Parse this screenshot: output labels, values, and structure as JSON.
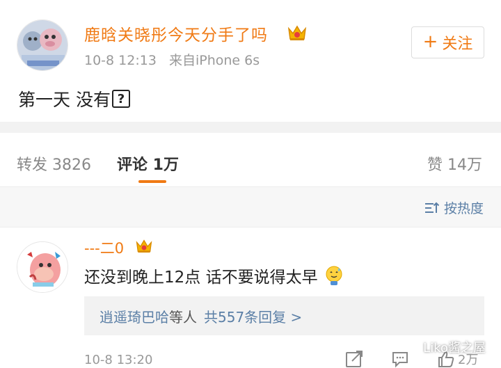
{
  "post": {
    "author": "鹿晗关晓彤今天分手了吗",
    "time": "10-8 12:13",
    "source": "来自iPhone 6s",
    "follow_label": "关注",
    "text": "第一天  没有",
    "emoji_icon": "question-box-icon"
  },
  "tabs": {
    "repost": "转发 3826",
    "comments": "评论 1万",
    "likes": "赞 14万"
  },
  "sort": {
    "label": "按热度"
  },
  "comment": {
    "author": "---二0",
    "text": "还没到晚上12点 话不要说得太早",
    "reply_users": "逍遥琦巴哈",
    "reply_mid": "等人",
    "reply_count": "共557条回复 >",
    "time": "10-8 13:20",
    "like_count": "2万"
  },
  "watermark": {
    "text": "Liko酱之屋"
  },
  "colors": {
    "accent": "#f07a14",
    "link": "#5b7fa6",
    "band": "#f2f2f2"
  }
}
